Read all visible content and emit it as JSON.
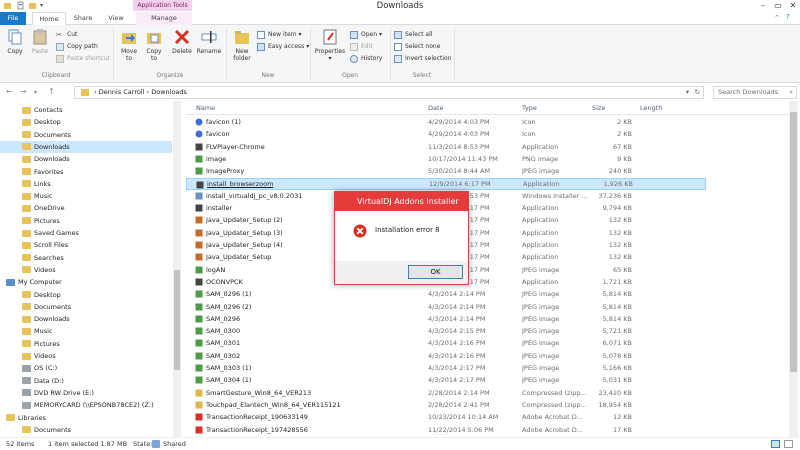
{
  "window": {
    "title": "Downloads",
    "context_tab": "Application Tools"
  },
  "tabs": {
    "file": "File",
    "home": "Home",
    "share": "Share",
    "view": "View",
    "manage": "Manage"
  },
  "ribbon": {
    "clipboard": {
      "copy": "Copy",
      "paste": "Paste",
      "cut": "Cut",
      "copy_path": "Copy path",
      "paste_shortcut": "Paste shortcut",
      "label": "Clipboard"
    },
    "organize": {
      "move_to": "Move to",
      "copy_to": "Copy to",
      "delete": "Delete",
      "rename": "Rename",
      "label": "Organize"
    },
    "new": {
      "new_folder": "New folder",
      "new_item": "New item",
      "easy_access": "Easy access",
      "label": "New"
    },
    "open": {
      "properties": "Properties",
      "open": "Open",
      "edit": "Edit",
      "history": "History",
      "label": "Open"
    },
    "select": {
      "select_all": "Select all",
      "select_none": "Select none",
      "invert": "Invert selection",
      "label": "Select"
    }
  },
  "address": {
    "crumb1": "Dennis Carroll",
    "crumb2": "Downloads",
    "search_placeholder": "Search Downloads"
  },
  "nav": [
    {
      "label": "Contacts"
    },
    {
      "label": "Desktop"
    },
    {
      "label": "Documents"
    },
    {
      "label": "Downloads"
    },
    {
      "label": "Downloads"
    },
    {
      "label": "Favorites"
    },
    {
      "label": "Links"
    },
    {
      "label": "Music"
    },
    {
      "label": "OneDrive"
    },
    {
      "label": "Pictures"
    },
    {
      "label": "Saved Games"
    },
    {
      "label": "Scroll Files"
    },
    {
      "label": "Searches"
    },
    {
      "label": "Videos"
    },
    {
      "label": "My Computer"
    },
    {
      "label": "Desktop"
    },
    {
      "label": "Documents"
    },
    {
      "label": "Downloads"
    },
    {
      "label": "Music"
    },
    {
      "label": "Pictures"
    },
    {
      "label": "Videos"
    },
    {
      "label": "OS (C:)"
    },
    {
      "label": "Data (D:)"
    },
    {
      "label": "DVD RW Drive (E:)"
    },
    {
      "label": "MEMORYCARD (\\\\EPSONB78CE2) (Z:)"
    },
    {
      "label": "Libraries"
    },
    {
      "label": "Documents"
    }
  ],
  "columns": {
    "name": "Name",
    "date": "Date",
    "type": "Type",
    "size": "Size",
    "length": "Length"
  },
  "files": [
    {
      "name": "favicon (1)",
      "date": "4/29/2014 4:03 PM",
      "type": "Icon",
      "size": "2 KB"
    },
    {
      "name": "favicon",
      "date": "4/29/2014 4:03 PM",
      "type": "Icon",
      "size": "2 KB"
    },
    {
      "name": "FLVPlayer-Chrome",
      "date": "11/3/2014 8:53 PM",
      "type": "Application",
      "size": "67 KB"
    },
    {
      "name": "image",
      "date": "10/17/2014 11:43 PM",
      "type": "PNG image",
      "size": "9 KB"
    },
    {
      "name": "ImageProxy",
      "date": "5/30/2014 8:44 AM",
      "type": "JPEG image",
      "size": "240 KB"
    },
    {
      "name": "install_browserzoom",
      "date": "12/9/2014 6:17 PM",
      "type": "Application",
      "size": "1,926 KB"
    },
    {
      "name": "install_virtualdj_pc_v8.0.2031",
      "date": "12/9/2014 5:53 PM",
      "type": "Windows Installer ...",
      "size": "37,236 KB"
    },
    {
      "name": "installer",
      "date": "12/9/2014 6:17 PM",
      "type": "Application",
      "size": "9,794 KB"
    },
    {
      "name": "Java_Updater_Setup (2)",
      "date": "12/9/2014 6:17 PM",
      "type": "Application",
      "size": "132 KB"
    },
    {
      "name": "Java_Updater_Setup (3)",
      "date": "12/9/2014 6:17 PM",
      "type": "Application",
      "size": "132 KB"
    },
    {
      "name": "Java_Updater_Setup (4)",
      "date": "12/9/2014 6:17 PM",
      "type": "Application",
      "size": "132 KB"
    },
    {
      "name": "Java_Updater_Setup",
      "date": "12/9/2014 6:17 PM",
      "type": "Application",
      "size": "132 KB"
    },
    {
      "name": "logAN",
      "date": "12/9/2014 6:17 PM",
      "type": "JPEG image",
      "size": "65 KB"
    },
    {
      "name": "OCONVPCK",
      "date": "12/9/2014 6:17 PM",
      "type": "Application",
      "size": "1,721 KB"
    },
    {
      "name": "SAM_0296 (1)",
      "date": "4/3/2014 2:14 PM",
      "type": "JPEG image",
      "size": "5,814 KB"
    },
    {
      "name": "SAM_0296 (2)",
      "date": "4/3/2014 2:14 PM",
      "type": "JPEG image",
      "size": "5,814 KB"
    },
    {
      "name": "SAM_0296",
      "date": "4/3/2014 2:14 PM",
      "type": "JPEG image",
      "size": "5,814 KB"
    },
    {
      "name": "SAM_0300",
      "date": "4/3/2014 2:15 PM",
      "type": "JPEG image",
      "size": "5,721 KB"
    },
    {
      "name": "SAM_0301",
      "date": "4/3/2014 2:16 PM",
      "type": "JPEG image",
      "size": "6,071 KB"
    },
    {
      "name": "SAM_0302",
      "date": "4/3/2014 2:16 PM",
      "type": "JPEG image",
      "size": "5,078 KB"
    },
    {
      "name": "SAM_0303 (1)",
      "date": "4/3/2014 2:17 PM",
      "type": "JPEG image",
      "size": "5,166 KB"
    },
    {
      "name": "SAM_0304 (1)",
      "date": "4/3/2014 2:17 PM",
      "type": "JPEG image",
      "size": "5,031 KB"
    },
    {
      "name": "SmartGesture_Win8_64_VER213",
      "date": "2/28/2014 2:14 PM",
      "type": "Compressed (zipp...",
      "size": "23,420 KB"
    },
    {
      "name": "Touchpad_Elantech_Win8_64_VER115121",
      "date": "2/28/2014 2:41 PM",
      "type": "Compressed (zipp...",
      "size": "18,954 KB"
    },
    {
      "name": "TransactionReceipt_190633149",
      "date": "10/23/2014 10:14 AM",
      "type": "Adobe Acrobat D...",
      "size": "12 KB"
    },
    {
      "name": "TransactionReceipt_197428556",
      "date": "11/22/2014 5:06 PM",
      "type": "Adobe Acrobat D...",
      "size": "17 KB"
    }
  ],
  "status": {
    "items": "52 items",
    "selected": "1 item selected  1.87 MB",
    "state_label": "State:",
    "state_value": "Shared"
  },
  "dialog": {
    "title": "VirtualDJ Addons Installer",
    "message": "Installation error 8",
    "ok": "OK"
  }
}
